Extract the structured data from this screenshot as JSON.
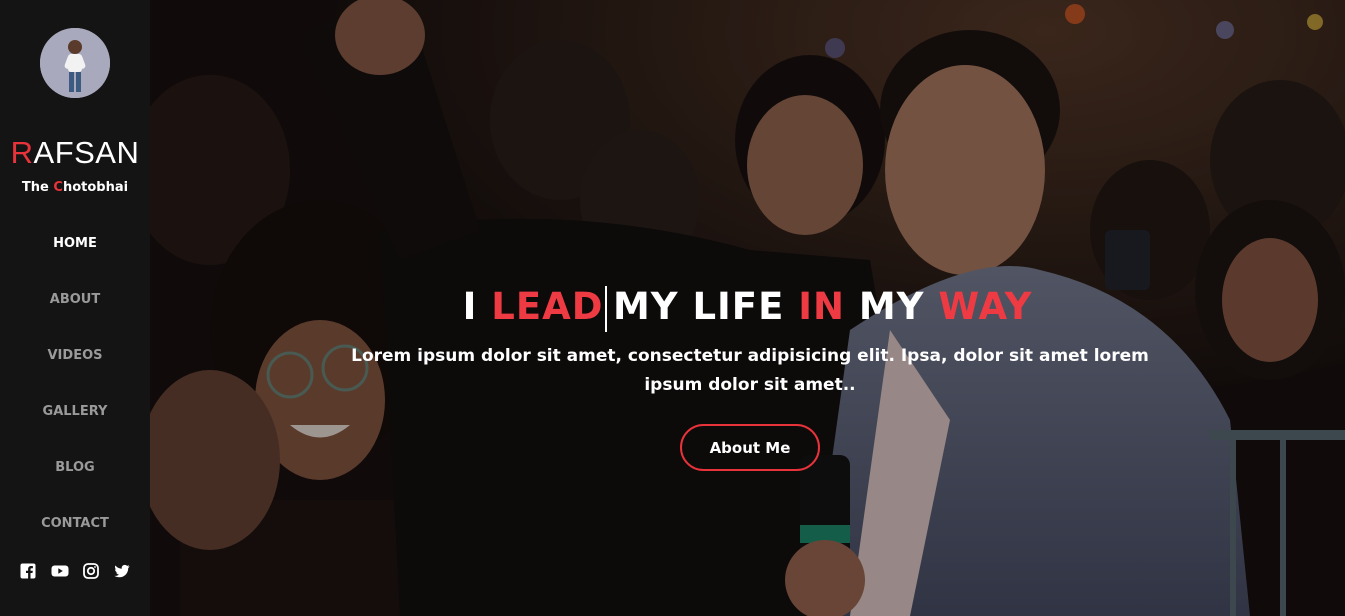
{
  "sidebar": {
    "brand_first": "R",
    "brand_rest": "AFSAN",
    "tagline_pre": "The ",
    "tagline_hl": "C",
    "tagline_rest": "hotobhai",
    "nav": [
      {
        "label": "HOME",
        "active": true
      },
      {
        "label": "ABOUT",
        "active": false
      },
      {
        "label": "VIDEOS",
        "active": false
      },
      {
        "label": "GALLERY",
        "active": false
      },
      {
        "label": "BLOG",
        "active": false
      },
      {
        "label": "CONTACT",
        "active": false
      }
    ],
    "socials": [
      "facebook-icon",
      "youtube-icon",
      "instagram-icon",
      "twitter-icon"
    ]
  },
  "hero": {
    "headline": {
      "w1": "I ",
      "w2": "LEAD",
      "w3": "MY LIFE ",
      "w4": "IN",
      "w5": " MY ",
      "w6": "WAY"
    },
    "lead_text": "Lorem ipsum dolor sit amet, consectetur adipisicing elit. Ipsa, dolor sit amet lorem ipsum dolor sit amet..",
    "cta_label": "About Me"
  },
  "colors": {
    "accent": "#e8333b",
    "sidebar_bg": "#141414",
    "nav_inactive": "#9a9a9a"
  }
}
